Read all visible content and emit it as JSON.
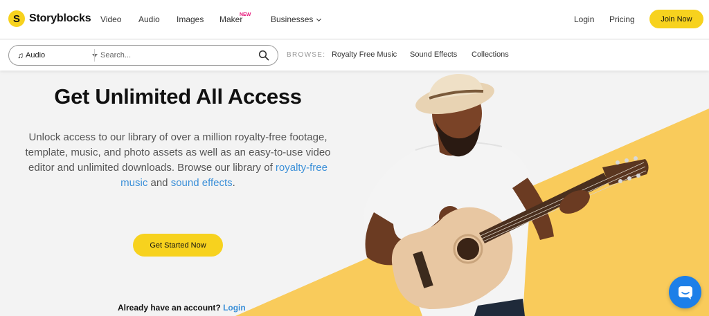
{
  "brand": {
    "name": "Storyblocks",
    "mark": "S",
    "accent": "#f7d21e"
  },
  "topnav": {
    "links": [
      {
        "label": "Video"
      },
      {
        "label": "Audio"
      },
      {
        "label": "Images"
      },
      {
        "label": "Maker",
        "badge": "NEW"
      },
      {
        "label": "Businesses"
      }
    ],
    "login": "Login",
    "pricing": "Pricing",
    "join": "Join Now"
  },
  "search": {
    "media_type": "Audio",
    "placeholder": "Search...",
    "browse_label": "BROWSE:",
    "browse_links": [
      "Royalty Free Music",
      "Sound Effects",
      "Collections"
    ]
  },
  "hero": {
    "title": "Get Unlimited All Access",
    "description": "Unlock access to our library of over a million royalty-free footage, template, music, and photo assets as well as an easy-to-use video editor and unlimited downloads. Browse our library of ",
    "link1": "royalty-free music",
    "and": " and ",
    "link2": "sound effects",
    "end": ".",
    "cta": "Get Started Now",
    "account_prompt": "Already have an account?",
    "account_login": "Login"
  },
  "colors": {
    "link": "#3a8fd8",
    "new_badge": "#e6177a",
    "chat": "#1c7fe8",
    "hero_bg": "#f3f3f3",
    "band": "#f9cb5b"
  },
  "icons": [
    "music-note-icon",
    "chevron-down-icon",
    "search-icon",
    "chat-icon"
  ]
}
